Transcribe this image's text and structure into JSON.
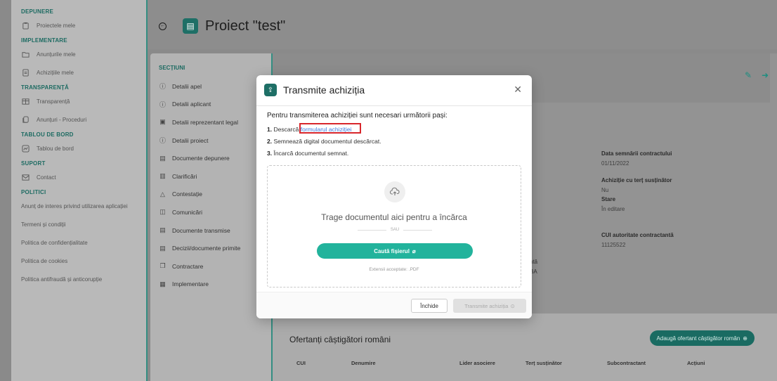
{
  "sidebar": {
    "sections": [
      {
        "title": "DEPUNERE",
        "items": [
          {
            "label": "Proiectele mele",
            "icon": "clipboard-icon"
          }
        ]
      },
      {
        "title": "IMPLEMENTARE",
        "items": [
          {
            "label": "Anunțurile mele",
            "icon": "folder-icon"
          },
          {
            "label": "Achizițiile mele",
            "icon": "document-icon"
          }
        ]
      },
      {
        "title": "TRANSPARENȚĂ",
        "items": [
          {
            "label": "Transparență",
            "icon": "table-icon"
          },
          {
            "label": "Anunțuri - Proceduri",
            "icon": "copy-icon"
          }
        ]
      },
      {
        "title": "TABLOU DE BORD",
        "items": [
          {
            "label": "Tablou de bord",
            "icon": "dashboard-icon"
          }
        ]
      },
      {
        "title": "SUPORT",
        "items": [
          {
            "label": "Contact",
            "icon": "mail-icon"
          }
        ]
      },
      {
        "title": "POLITICI",
        "items": [
          {
            "label": "Anunț de interes privind utilizarea aplicației"
          },
          {
            "label": "Termeni și condiții"
          },
          {
            "label": "Politica de confidențialitate"
          },
          {
            "label": "Politica de cookies"
          },
          {
            "label": "Politica antifraudă și anticorupție"
          }
        ]
      }
    ]
  },
  "header": {
    "title": "Proiect \"test\""
  },
  "sections_panel": {
    "title": "SECȚIUNI",
    "items": [
      {
        "label": "Detalii apel",
        "icon": "info-icon"
      },
      {
        "label": "Detalii aplicant",
        "icon": "info-icon"
      },
      {
        "label": "Detalii reprezentant legal",
        "icon": "id-card-icon"
      },
      {
        "label": "Detalii proiect",
        "icon": "info-icon"
      },
      {
        "label": "Documente depunere",
        "icon": "document-icon"
      },
      {
        "label": "Clarificări",
        "icon": "clipboard-icon"
      },
      {
        "label": "Contestație",
        "icon": "warning-icon"
      },
      {
        "label": "Comunicări",
        "icon": "chat-icon"
      },
      {
        "label": "Documente transmise",
        "icon": "document-icon"
      },
      {
        "label": "Decizii/documente primite",
        "icon": "document-icon"
      },
      {
        "label": "Contractare",
        "icon": "copy-icon"
      },
      {
        "label": "Implementare",
        "icon": "table-icon"
      }
    ]
  },
  "details": {
    "fields": [
      {
        "label": "Data semnării contractului",
        "value": "01/11/2022"
      },
      {
        "label": "Achiziție cu terț susținător",
        "value": "Nu"
      },
      {
        "label": "Stare",
        "value": "În editare"
      },
      {
        "label": "CUI autoritate contractantă",
        "value": "11125522"
      }
    ],
    "fragment_a": "ntă",
    "fragment_b": "BA"
  },
  "winners": {
    "title": "Ofertanți câștigători români",
    "add_button": "Adaugă ofertant câștigător român",
    "columns": [
      "CUI",
      "Denumire",
      "Lider asociere",
      "Terț susținător",
      "Subcontractant",
      "Acțiuni"
    ]
  },
  "modal": {
    "title": "Transmite achiziția",
    "intro": "Pentru transmiterea achiziției sunt necesari următorii pași:",
    "steps": [
      {
        "num": "1.",
        "text": "Descarcă ",
        "link": "formularul achiziției"
      },
      {
        "num": "2.",
        "text": "Semnează digital documentul descărcat."
      },
      {
        "num": "3.",
        "text": "Încarcă documentul semnat."
      }
    ],
    "drop_text": "Trage documentul aici pentru a încărca",
    "or_text": "SAU",
    "search_button": "Caută fișierul",
    "extensions": "Extensii acceptate: .PDF",
    "close_button": "Închide",
    "send_button": "Transmite achiziția"
  },
  "colors": {
    "accent": "#22b39c",
    "brand_dark": "#1e6f66",
    "highlight": "#d8262c"
  }
}
